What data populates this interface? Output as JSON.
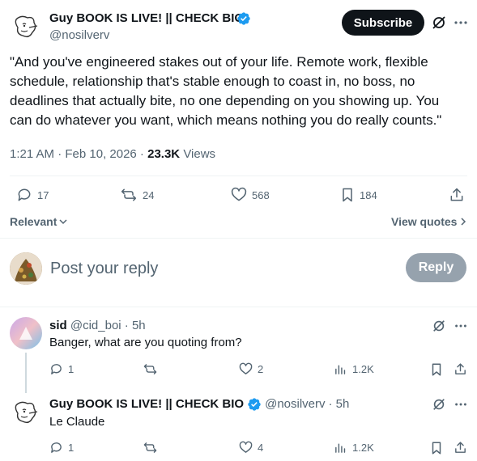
{
  "main_post": {
    "author_name": "Guy BOOK IS LIVE! || CHECK BIO",
    "handle": "@nosilverv",
    "subscribe_label": "Subscribe",
    "text": "\"And you've engineered stakes out of your life. Remote work, flexible schedule, relationship that's stable enough to coast in, no boss, no deadlines that actually bite, no one depending on you showing up. You can do whatever you want, which means nothing you do really counts.\"",
    "timestamp": "1:21 AM · Feb 10, 2026 · ",
    "views_count": "23.3K",
    "views_label": "Views",
    "replies": "17",
    "reposts": "24",
    "likes": "568",
    "bookmarks": "184"
  },
  "filters": {
    "sort_label": "Relevant",
    "view_quotes_label": "View quotes"
  },
  "compose": {
    "placeholder": "Post your reply",
    "reply_button": "Reply"
  },
  "replies": [
    {
      "name": "sid",
      "handle": "@cid_boi",
      "time": "· 5h",
      "text": "Banger, what are you quoting from?",
      "replies": "1",
      "reposts": "",
      "likes": "2",
      "views": "1.2K"
    },
    {
      "name": "Guy BOOK IS LIVE! || CHECK BIO",
      "handle": "@nosilverv",
      "time": "· 5h",
      "text": "Le Claude",
      "replies": "1",
      "reposts": "",
      "likes": "4",
      "views": "1.2K"
    }
  ],
  "colors": {
    "verified": "#1d9bf0",
    "text_primary": "#0f1419",
    "text_muted": "#536471"
  }
}
